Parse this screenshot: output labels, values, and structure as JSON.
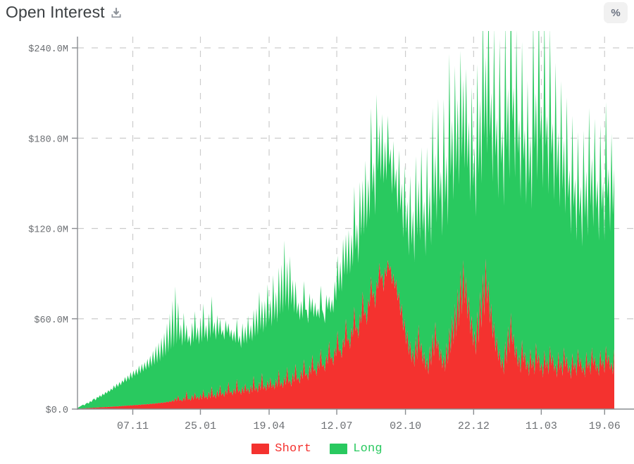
{
  "header": {
    "title": "Open Interest",
    "download_icon": "download-icon",
    "percent_button_label": "%"
  },
  "colors": {
    "short": "#f4322f",
    "long": "#29c95f",
    "axis": "#8a8d91",
    "grid": "#cccccc",
    "tick_text": "#6c6f73",
    "title_text": "#3c4043",
    "button_bg": "#f1f1f1"
  },
  "chart_data": {
    "type": "area",
    "stacked": true,
    "title": "Open Interest",
    "xlabel": "",
    "ylabel": "",
    "ylim": [
      0,
      240
    ],
    "y_unit": "M",
    "y_prefix": "$",
    "grid": true,
    "legend_position": "bottom",
    "y_ticks": [
      0,
      60,
      120,
      180,
      240
    ],
    "y_tick_labels": [
      "$0.0",
      "$60.0M",
      "$120.0M",
      "$180.0M",
      "$240.0M"
    ],
    "x_tick_labels": [
      "07.11",
      "25.01",
      "19.04",
      "12.07",
      "02.10",
      "22.12",
      "11.03",
      "19.06"
    ],
    "x_tick_positions": [
      0.103,
      0.229,
      0.357,
      0.483,
      0.611,
      0.738,
      0.864,
      0.982
    ],
    "series": [
      {
        "name": "Short",
        "color": "#f4322f",
        "values": [
          0.2,
          0.3,
          0.3,
          0.4,
          0.5,
          0.4,
          0.6,
          0.7,
          0.6,
          0.8,
          0.7,
          0.9,
          1.0,
          0.8,
          1.1,
          1.0,
          1.2,
          1.1,
          1.3,
          1.2,
          1.4,
          1.3,
          1.5,
          1.4,
          1.6,
          1.5,
          1.8,
          1.6,
          1.9,
          1.7,
          2.0,
          1.8,
          2.1,
          2.0,
          2.3,
          2.1,
          2.4,
          2.2,
          2.6,
          2.3,
          2.7,
          2.5,
          2.8,
          2.6,
          3.0,
          2.7,
          3.1,
          2.9,
          3.2,
          3.0,
          3.4,
          3.1,
          3.6,
          3.3,
          3.8,
          3.4,
          4.0,
          3.6,
          4.2,
          3.8,
          4.4,
          4.0,
          4.6,
          4.2,
          5.0,
          4.4,
          5.4,
          4.6,
          6.0,
          4.8,
          7.5,
          5.2,
          9.0,
          5.6,
          6.2,
          5.0,
          8.0,
          5.4,
          12.0,
          6.0,
          7.0,
          5.5,
          9.5,
          6.2,
          11.0,
          6.6,
          8.5,
          6.0,
          10.0,
          6.4,
          13.0,
          7.0,
          9.0,
          6.5,
          11.5,
          7.2,
          15.0,
          7.8,
          10.0,
          7.0,
          12.5,
          8.0,
          16.0,
          9.0,
          11.0,
          8.0,
          13.0,
          9.5,
          18.0,
          10.5,
          12.0,
          9.0,
          14.0,
          10.0,
          20.0,
          11.0,
          13.0,
          9.5,
          15.0,
          10.5,
          17.0,
          11.5,
          14.0,
          10.0,
          16.0,
          11.0,
          22.0,
          12.0,
          15.0,
          11.0,
          18.0,
          12.5,
          24.0,
          13.0,
          16.0,
          12.0,
          19.0,
          13.5,
          21.0,
          14.0,
          17.0,
          13.0,
          20.0,
          14.5,
          26.0,
          15.0,
          18.0,
          14.0,
          22.0,
          16.0,
          28.0,
          17.0,
          19.5,
          15.0,
          24.0,
          18.0,
          30.0,
          19.0,
          21.0,
          17.0,
          26.0,
          20.0,
          33.0,
          22.0,
          24.0,
          19.0,
          29.0,
          23.0,
          36.0,
          25.0,
          27.0,
          22.0,
          32.0,
          26.0,
          40.0,
          28.0,
          30.0,
          25.0,
          36.0,
          30.0,
          45.0,
          33.0,
          35.0,
          29.0,
          41.0,
          35.0,
          52.0,
          38.0,
          40.0,
          34.0,
          47.0,
          41.0,
          60.0,
          45.0,
          47.0,
          40.0,
          54.0,
          48.0,
          68.0,
          52.0,
          55.0,
          47.0,
          63.0,
          57.0,
          78.0,
          62.0,
          65.0,
          56.0,
          73.0,
          68.0,
          88.0,
          74.0,
          78.0,
          67.0,
          85.0,
          80.0,
          97.0,
          86.0,
          90.0,
          78.0,
          94.0,
          88.0,
          99.0,
          92.0,
          95.0,
          83.0,
          90.0,
          80.0,
          86.0,
          72.0,
          78.0,
          62.0,
          70.0,
          52.0,
          60.0,
          43.0,
          52.0,
          36.0,
          45.0,
          31.0,
          40.0,
          28.0,
          48.0,
          33.0,
          56.0,
          38.0,
          44.0,
          30.0,
          38.0,
          26.0,
          34.0,
          23.0,
          42.0,
          29.0,
          50.0,
          35.0,
          58.0,
          40.0,
          46.0,
          32.0,
          40.0,
          27.0,
          36.0,
          25.0,
          44.0,
          30.0,
          54.0,
          37.0,
          62.0,
          43.0,
          70.0,
          48.0,
          80.0,
          55.0,
          92.0,
          63.0,
          99.0,
          70.0,
          88.0,
          60.0,
          75.0,
          50.0,
          62.0,
          42.0,
          52.0,
          36.0,
          65.0,
          44.0,
          78.0,
          54.0,
          90.0,
          62.0,
          100.0,
          70.0,
          85.0,
          57.0,
          70.0,
          47.0,
          58.0,
          38.0,
          48.0,
          32.0,
          40.0,
          27.0,
          34.0,
          23.0,
          45.0,
          30.0,
          55.0,
          37.0,
          64.0,
          43.0,
          50.0,
          34.0,
          42.0,
          28.0,
          36.0,
          24.0,
          46.0,
          31.0,
          38.0,
          26.0,
          32.0,
          22.0,
          40.0,
          27.0,
          34.0,
          23.0,
          44.0,
          30.0,
          37.0,
          25.0,
          31.0,
          21.0,
          39.0,
          27.0,
          33.0,
          23.0,
          42.0,
          29.0,
          36.0,
          25.0,
          30.0,
          21.0,
          38.0,
          26.0,
          32.0,
          22.0,
          41.0,
          28.0,
          35.0,
          24.0,
          29.0,
          20.0,
          37.0,
          26.0,
          31.0,
          22.0,
          40.0,
          28.0,
          34.0,
          24.0,
          29.0,
          21.0,
          38.0,
          27.0,
          32.0,
          23.0,
          41.0,
          29.0,
          35.0,
          25.0,
          30.0,
          22.0,
          39.0,
          28.0,
          33.0,
          24.0,
          42.0,
          30.0,
          36.0,
          26.0,
          31.0,
          23.0,
          40.0
        ]
      },
      {
        "name": "Long",
        "color": "#29c95f",
        "values": [
          0.5,
          1.0,
          1.5,
          2.0,
          2.5,
          2.0,
          3.0,
          3.5,
          3.0,
          4.5,
          4.0,
          5.5,
          6.0,
          5.0,
          7.0,
          6.5,
          8.0,
          7.0,
          9.0,
          8.0,
          10.0,
          9.0,
          11.0,
          10.0,
          12.0,
          11.0,
          14.0,
          12.0,
          15.0,
          13.0,
          16.0,
          14.0,
          17.0,
          15.5,
          19.0,
          16.0,
          20.0,
          17.0,
          22.0,
          18.0,
          23.0,
          19.5,
          24.0,
          20.0,
          26.0,
          21.0,
          27.0,
          22.0,
          28.0,
          23.0,
          30.0,
          24.0,
          32.0,
          25.0,
          35.0,
          26.0,
          38.0,
          27.0,
          40.0,
          28.0,
          43.0,
          30.0,
          46.0,
          31.0,
          52.0,
          33.0,
          58.0,
          35.0,
          66.0,
          36.0,
          74.0,
          38.0,
          62.0,
          40.0,
          50.0,
          37.0,
          56.0,
          39.0,
          44.0,
          38.0,
          42.0,
          36.0,
          48.0,
          38.0,
          54.0,
          39.0,
          46.0,
          37.0,
          50.0,
          38.0,
          57.0,
          40.0,
          47.0,
          38.0,
          52.0,
          40.0,
          60.0,
          42.0,
          48.0,
          39.0,
          50.0,
          41.0,
          44.0,
          40.0,
          42.0,
          38.0,
          46.0,
          41.0,
          39.0,
          37.0,
          41.0,
          36.0,
          38.0,
          34.0,
          40.0,
          33.0,
          36.0,
          31.0,
          42.0,
          33.0,
          38.0,
          32.0,
          48.0,
          36.0,
          40.0,
          34.0,
          44.0,
          36.0,
          52.0,
          38.0,
          60.0,
          40.0,
          48.0,
          38.0,
          56.0,
          42.0,
          64.0,
          44.0,
          52.0,
          41.0,
          72.0,
          46.0,
          58.0,
          43.0,
          68.0,
          48.0,
          78.0,
          50.0,
          90.0,
          52.0,
          70.0,
          48.0,
          82.0,
          54.0,
          62.0,
          46.0,
          55.0,
          44.0,
          50.0,
          42.0,
          46.0,
          40.0,
          52.0,
          44.0,
          42.0,
          38.0,
          48.0,
          41.0,
          38.0,
          36.0,
          44.0,
          39.0,
          35.0,
          34.0,
          42.0,
          38.0,
          33.0,
          32.0,
          40.0,
          36.0,
          30.0,
          31.0,
          38.0,
          35.0,
          44.0,
          37.0,
          50.0,
          40.0,
          58.0,
          44.0,
          66.0,
          48.0,
          56.0,
          44.0,
          72.0,
          50.0,
          62.0,
          47.0,
          80.0,
          54.0,
          68.0,
          50.0,
          88.0,
          58.0,
          74.0,
          54.0,
          100.0,
          64.0,
          80.0,
          58.0,
          112.0,
          70.0,
          86.0,
          62.0,
          124.0,
          78.0,
          92.0,
          66.0,
          106.0,
          72.0,
          84.0,
          64.0,
          96.0,
          70.0,
          78.0,
          60.0,
          88.0,
          66.0,
          74.0,
          58.0,
          94.0,
          70.0,
          80.0,
          62.0,
          102.0,
          74.0,
          86.0,
          66.0,
          110.0,
          78.0,
          92.0,
          70.0,
          120.0,
          82.0,
          96.0,
          74.0,
          130.0,
          88.0,
          100.0,
          76.0,
          140.0,
          94.0,
          106.0,
          80.0,
          150.0,
          100.0,
          112.0,
          84.0,
          160.0,
          106.0,
          118.0,
          88.0,
          170.0,
          112.0,
          124.0,
          92.0,
          182.0,
          118.0,
          130.0,
          96.0,
          158.0,
          110.0,
          126.0,
          94.0,
          146.0,
          104.0,
          120.0,
          90.0,
          138.0,
          100.0,
          116.0,
          88.0,
          152.0,
          106.0,
          122.0,
          92.0,
          164.0,
          112.0,
          128.0,
          96.0,
          176.0,
          118.0,
          134.0,
          100.0,
          188.0,
          124.0,
          140.0,
          104.0,
          196.0,
          130.0,
          146.0,
          108.0,
          206.0,
          136.0,
          152.0,
          112.0,
          214.0,
          142.0,
          158.0,
          116.0,
          222.0,
          148.0,
          164.0,
          120.0,
          210.0,
          142.0,
          156.0,
          116.0,
          198.0,
          134.0,
          148.0,
          110.0,
          186.0,
          128.0,
          142.0,
          106.0,
          228.0,
          150.0,
          166.0,
          122.0,
          234.0,
          154.0,
          170.0,
          126.0,
          224.0,
          148.0,
          162.0,
          120.0,
          212.0,
          140.0,
          154.0,
          114.0,
          200.0,
          132.0,
          146.0,
          108.0,
          186.0,
          124.0,
          138.0,
          102.0,
          172.0,
          116.0,
          130.0,
          96.0,
          158.0,
          108.0,
          122.0,
          90.0,
          144.0,
          100.0,
          114.0,
          84.0,
          156.0,
          106.0,
          120.0,
          88.0,
          168.0,
          112.0,
          126.0,
          92.0,
          158.0,
          108.0,
          122.0,
          90.0,
          150.0,
          104.0,
          118.0,
          88.0,
          162.0,
          110.0,
          124.0,
          92.0,
          152.0,
          106.0,
          120.0,
          90.0,
          144.0,
          102.0,
          116.0,
          88.0,
          158.0,
          108.0,
          122.0,
          92.0,
          148.0,
          104.0,
          118.0,
          90.0,
          140.0,
          100.0,
          114.0,
          86.0,
          152.0,
          106.0,
          120.0,
          90.0,
          142.0
        ]
      }
    ]
  },
  "legend": {
    "items": [
      {
        "label": "Short",
        "color": "#f4322f"
      },
      {
        "label": "Long",
        "color": "#29c95f"
      }
    ]
  }
}
